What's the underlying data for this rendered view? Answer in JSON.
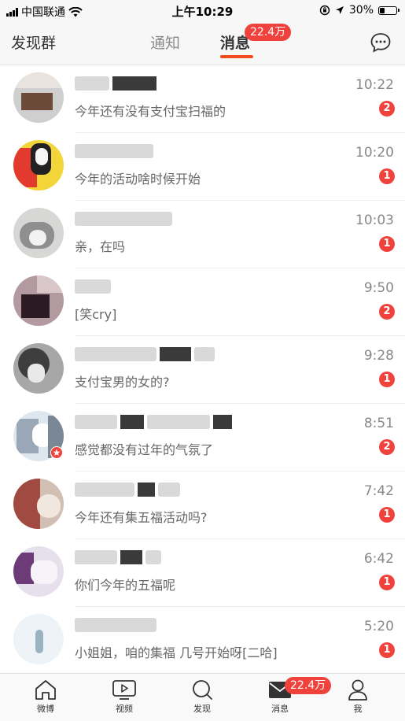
{
  "status_bar": {
    "carrier": "中国联通",
    "time": "上午10:29",
    "battery": "30%",
    "battery_level": 0.3
  },
  "header": {
    "discover_groups": "发现群",
    "tab_notice": "通知",
    "tab_message": "消息",
    "message_badge": "22.4万"
  },
  "messages": [
    {
      "name": "",
      "preview": "今年还有没有支付宝扫福的",
      "time": "10:22",
      "count": "2"
    },
    {
      "name": "",
      "preview": "今年的活动啥时候开始",
      "time": "10:20",
      "count": "1"
    },
    {
      "name": "",
      "preview": "亲，在吗",
      "time": "10:03",
      "count": "1"
    },
    {
      "name": "",
      "preview": "[笑cry]",
      "time": "9:50",
      "count": "2"
    },
    {
      "name": "",
      "preview": "支付宝男的女的?",
      "time": "9:28",
      "count": "1"
    },
    {
      "name": "",
      "preview": "感觉都没有过年的气氛了",
      "time": "8:51",
      "count": "2"
    },
    {
      "name": "",
      "preview": "今年还有集五福活动吗?",
      "time": "7:42",
      "count": "1"
    },
    {
      "name": "",
      "preview": "你们今年的五福呢",
      "time": "6:42",
      "count": "1"
    },
    {
      "name": "",
      "preview": "小姐姐，咱的集福 几号开始呀[二哈]",
      "time": "5:20",
      "count": "1"
    }
  ],
  "tabbar": {
    "home": "微博",
    "video": "视频",
    "discover": "发现",
    "message": "消息",
    "me": "我",
    "message_badge": "22.4万"
  },
  "colors": {
    "accent": "#f24c1a",
    "badge": "#f0423c"
  }
}
